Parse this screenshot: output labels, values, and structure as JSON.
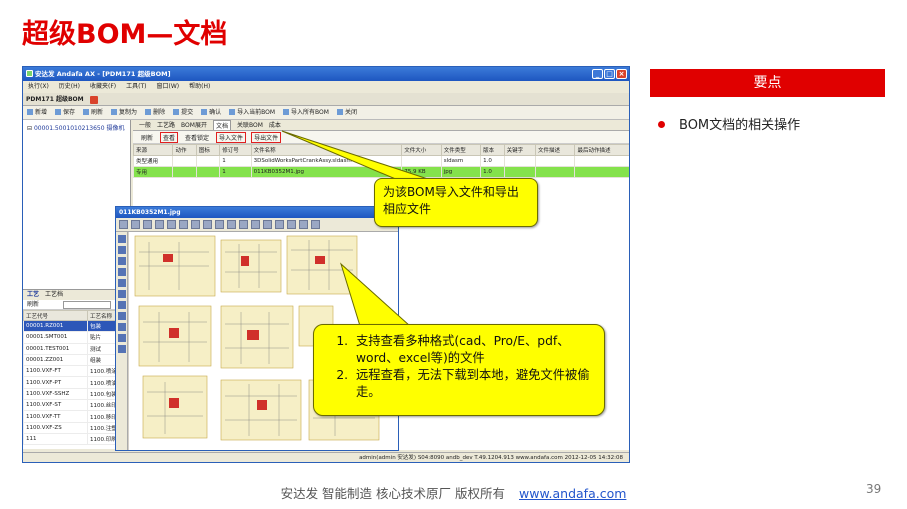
{
  "slide": {
    "title": "超级BOM—文档",
    "page_number": "39",
    "footer_text": "安达发   智能制造 核心技术原厂   版权所有",
    "footer_link": "www.andafa.com"
  },
  "keypoints": {
    "header": "要点",
    "items": [
      "BOM文档的相关操作"
    ]
  },
  "callouts": {
    "import_export": "为该BOM导入文件和导出相应文件",
    "view": [
      "支持查看多种格式(cad、Pro/E、pdf、word、excel等)的文件",
      "远程查看，无法下载到本地，避免文件被偷走。"
    ]
  },
  "app": {
    "title": "安达发  Andafa AX  -  [PDM171 超级BOM]",
    "menu": [
      "执行(X)",
      "历史(H)",
      "收藏夹(F)",
      "工具(T)",
      "窗口(W)",
      "帮助(H)"
    ],
    "doc_tab": "PDM171 超级BOM",
    "toolbar": [
      "新增",
      "保存",
      "刷新",
      "复制为",
      "删除",
      "提交",
      "确认",
      "导入当前BOM",
      "导入所有BOM",
      "关闭"
    ],
    "tree_node": "00001.5001010213650 摄像机",
    "tabs": [
      "一般",
      "工艺路",
      "BOM展开",
      "文档",
      "关联BOM",
      "成本"
    ],
    "active_tab": "文档",
    "doc_toolbar": {
      "refresh": "刷新",
      "view": "查看",
      "view_lock": "查看锁定",
      "import": "导入文件",
      "export": "导出文件"
    },
    "doc_columns": [
      "来源",
      "动作",
      "图标",
      "修订号",
      "文件名称",
      "文件大小",
      "文件类型",
      "版本",
      "关键字",
      "文件描述",
      "最后动作描述"
    ],
    "doc_rows": [
      [
        "类型通用",
        "",
        "",
        "1",
        "3DSolidWorksPartCrankAssy.sldasm",
        "",
        "sldasm",
        "1.0",
        "",
        "",
        ""
      ],
      [
        "专用",
        "",
        "",
        "1",
        "011KB0352M1.jpg",
        "75.9 KB",
        "jpg",
        "1.0",
        "",
        "",
        ""
      ]
    ],
    "route_tabs": [
      "工艺",
      "工艺档"
    ],
    "route_refresh": "刷新",
    "route_columns": [
      "工艺代号",
      "工艺名称"
    ],
    "route_rows": [
      [
        "00001.RZ001",
        "包装"
      ],
      [
        "00001.SMT001",
        "贴片"
      ],
      [
        "00001.TEST001",
        "测试"
      ],
      [
        "00001.ZZ001",
        "组装"
      ],
      [
        "1100.VXF-FT",
        "1100.喷涂"
      ],
      [
        "1100.VXF-PT",
        "1100.喷油"
      ],
      [
        "1100.VXF-SSHZ",
        "1100.包装"
      ],
      [
        "1100.VXF-ST",
        "1100.丝印"
      ],
      [
        "1100.VXF-TT",
        "1100.移印"
      ],
      [
        "1100.VXF-ZS",
        "1100.注塑"
      ],
      [
        "111",
        "1100.印刷"
      ]
    ],
    "status": "admin(admin 安达发)  S04:8090   andb_dev  T.49.1204.913  www.andafa.com  2012-12-05 14:32:08"
  },
  "viewer": {
    "title": "011KB0352M1.jpg"
  },
  "colors": {
    "title_red": "#e00000",
    "callout_yellow": "#ffff00",
    "selected_row_green": "#84e24c"
  }
}
